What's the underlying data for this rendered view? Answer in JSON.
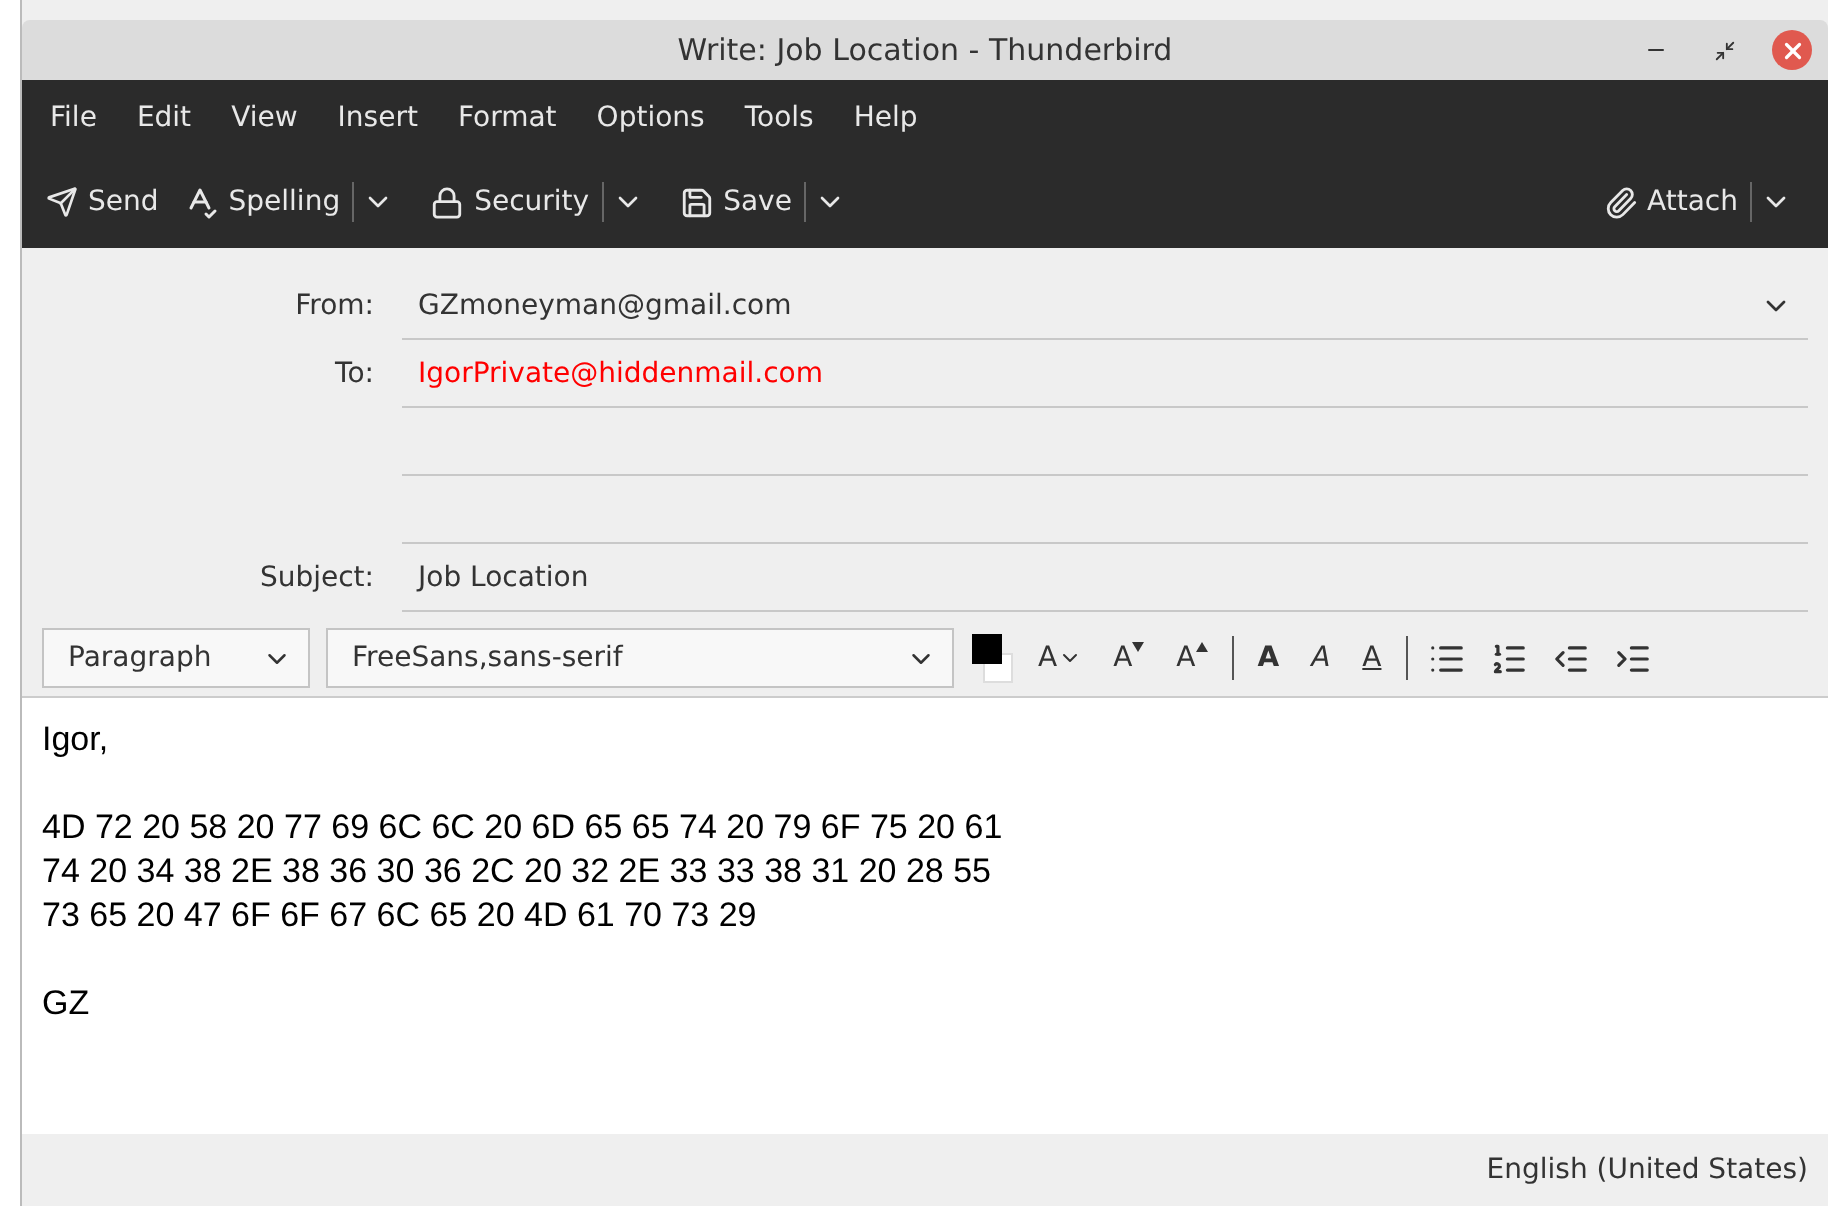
{
  "window": {
    "title": "Write: Job Location - Thunderbird"
  },
  "menu": [
    "File",
    "Edit",
    "View",
    "Insert",
    "Format",
    "Options",
    "Tools",
    "Help"
  ],
  "toolbar": [
    {
      "kind": "send",
      "label": "Send",
      "dropdown": false
    },
    {
      "kind": "spelling",
      "label": "Spelling",
      "dropdown": true
    },
    {
      "kind": "security",
      "label": "Security",
      "dropdown": true
    },
    {
      "kind": "save",
      "label": "Save",
      "dropdown": true
    },
    {
      "kind": "attach",
      "label": "Attach",
      "dropdown": true
    }
  ],
  "header": {
    "from": {
      "label": "From:",
      "value": "GZmoneyman@gmail.com"
    },
    "to": {
      "label": "To:",
      "value": "IgorPrivate@hiddenmail.com",
      "color": "#ff0000"
    },
    "subject": {
      "label": "Subject:",
      "value": "Job Location"
    }
  },
  "format_bar": {
    "paragraph": "Paragraph",
    "font": "FreeSans,sans-serif",
    "buttons": [
      {
        "kind": "size",
        "glyph": "A"
      },
      {
        "kind": "smaller",
        "glyph": "A"
      },
      {
        "kind": "larger",
        "glyph": "A"
      },
      {
        "kind": "bold",
        "glyph": "A"
      },
      {
        "kind": "italic",
        "glyph": "A"
      },
      {
        "kind": "underline",
        "glyph": "A"
      }
    ]
  },
  "body": [
    [
      "Igor,"
    ],
    [
      "4D 72 20 58 20 77 69 6C 6C 20 6D 65 65 74 20 79 6F 75 20 61",
      "74 20 34 38 2E 38 36 30 36 2C 20 32 2E 33 33 38 31 20 28 55",
      "73 65 20 47 6F 6F 67 6C 65 20 4D 61 70 73 29"
    ],
    [
      "GZ"
    ]
  ],
  "status_bar": {
    "language": "English (United States)"
  }
}
